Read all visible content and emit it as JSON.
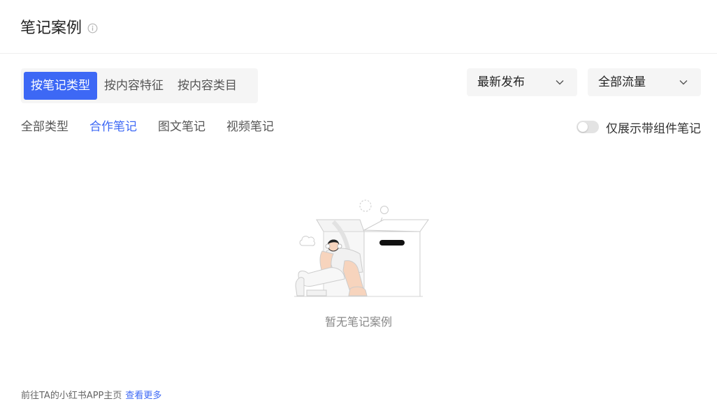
{
  "header": {
    "title": "笔记案例",
    "info_icon": "info-circle-icon"
  },
  "view_tabs": {
    "items": [
      "按笔记类型",
      "按内容特征",
      "按内容类目"
    ],
    "active_index": 0
  },
  "sort_dropdown": {
    "value": "最新发布",
    "icon": "chevron-down-icon"
  },
  "traffic_dropdown": {
    "value": "全部流量",
    "icon": "chevron-down-icon"
  },
  "type_filters": {
    "items": [
      "全部类型",
      "合作笔记",
      "图文笔记",
      "视频笔记"
    ],
    "active_index": 1
  },
  "component_toggle": {
    "label": "仅展示带组件笔记",
    "on": false
  },
  "empty_state": {
    "text": "暂无笔记案例"
  },
  "footer": {
    "text": "前往TA的小红书APP主页",
    "link_label": "查看更多"
  },
  "colors": {
    "accent": "#3d68f5",
    "panel_bg": "#f5f5f5",
    "muted_text": "#888888"
  }
}
